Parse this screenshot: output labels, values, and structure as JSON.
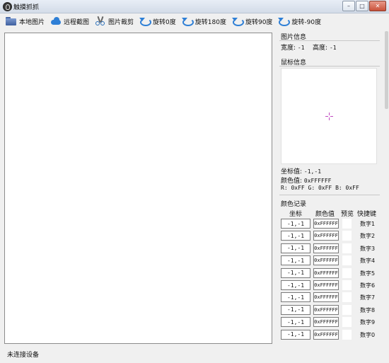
{
  "window": {
    "title": "触摸抓抓"
  },
  "toolbar": {
    "items": [
      {
        "label": "本地图片",
        "icon": "folder-icon"
      },
      {
        "label": "远程截图",
        "icon": "cloud-icon"
      },
      {
        "label": "图片裁剪",
        "icon": "scissors-icon"
      },
      {
        "label": "旋转0度",
        "icon": "rotate-icon"
      },
      {
        "label": "旋转180度",
        "icon": "rotate-icon"
      },
      {
        "label": "旋转90度",
        "icon": "rotate-icon"
      },
      {
        "label": "旋转-90度",
        "icon": "rotate-icon"
      }
    ]
  },
  "image_info": {
    "title": "图片信息",
    "width_label": "宽度:",
    "width_value": "-1",
    "height_label": "高度:",
    "height_value": "-1"
  },
  "mouse_info": {
    "title": "鼠标信息",
    "coord_label": "坐标值:",
    "coord_value": "-1,-1",
    "color_label": "颜色值:",
    "color_value": "0xFFFFFF",
    "rgb": "R: 0xFF  G: 0xFF  B: 0xFF"
  },
  "color_record": {
    "title": "颜色记录",
    "headers": {
      "coord": "坐标",
      "color": "颜色值",
      "preview": "预览",
      "shortcut": "快捷键"
    },
    "rows": [
      {
        "coord": "-1,-1",
        "color": "0xFFFFFF",
        "key": "数字1"
      },
      {
        "coord": "-1,-1",
        "color": "0xFFFFFF",
        "key": "数字2"
      },
      {
        "coord": "-1,-1",
        "color": "0xFFFFFF",
        "key": "数字3"
      },
      {
        "coord": "-1,-1",
        "color": "0xFFFFFF",
        "key": "数字4"
      },
      {
        "coord": "-1,-1",
        "color": "0xFFFFFF",
        "key": "数字5"
      },
      {
        "coord": "-1,-1",
        "color": "0xFFFFFF",
        "key": "数字6"
      },
      {
        "coord": "-1,-1",
        "color": "0xFFFFFF",
        "key": "数字7"
      },
      {
        "coord": "-1,-1",
        "color": "0xFFFFFF",
        "key": "数字8"
      },
      {
        "coord": "-1,-1",
        "color": "0xFFFFFF",
        "key": "数字9"
      },
      {
        "coord": "-1,-1",
        "color": "0xFFFFFF",
        "key": "数字0"
      }
    ]
  },
  "status": {
    "text": "未连接设备"
  },
  "colors": {
    "crosshair": "#c04ac0",
    "accent": "#2e7fd6"
  }
}
